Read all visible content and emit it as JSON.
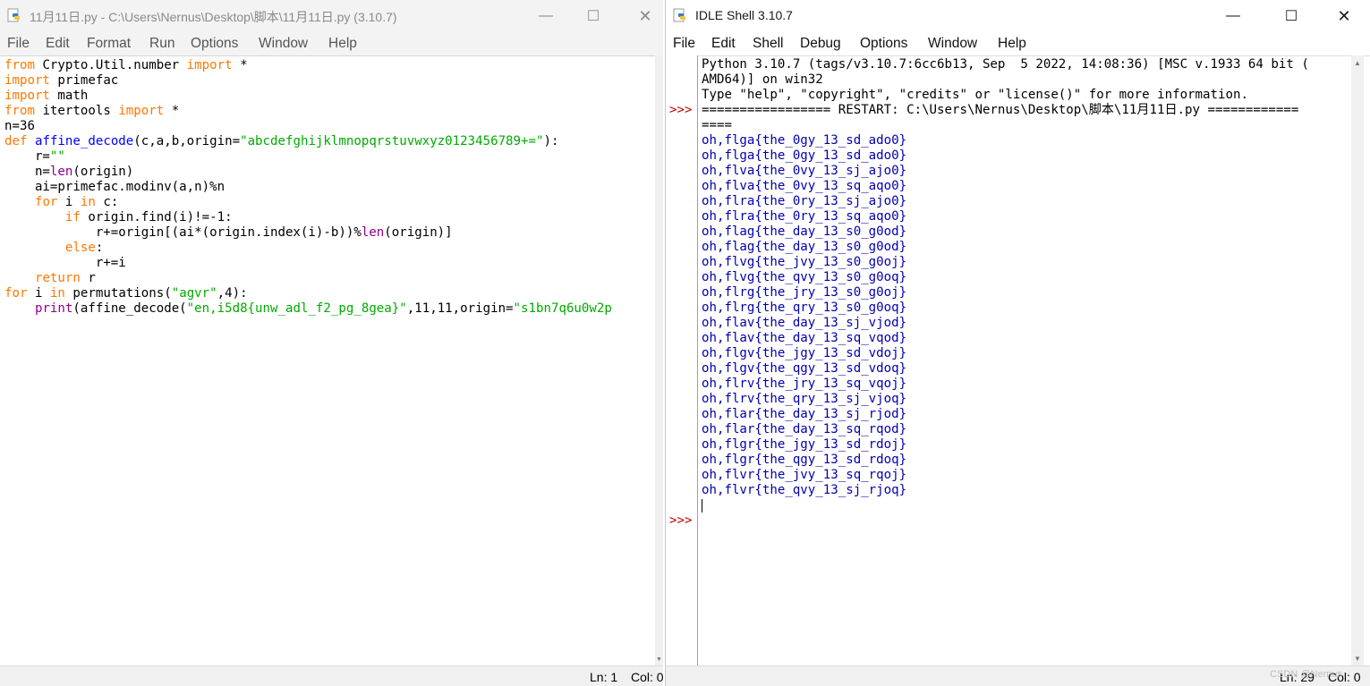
{
  "editor": {
    "title": "11月11日.py - C:\\Users\\Nernus\\Desktop\\脚本\\11月11日.py (3.10.7)",
    "menu": [
      "File",
      "Edit",
      "Format",
      "Run",
      "Options",
      "Window",
      "Help"
    ],
    "code": {
      "l1": {
        "a": "from",
        "b": " Crypto.Util.number ",
        "c": "import",
        "d": " *"
      },
      "l2": {
        "a": "import",
        "b": " primefac"
      },
      "l3": {
        "a": "import",
        "b": " math"
      },
      "l4": {
        "a": "from",
        "b": " itertools ",
        "c": "import",
        "d": " *"
      },
      "l5": {
        "a": "n=36"
      },
      "l6": {
        "a": "def",
        "b": " ",
        "c": "affine_decode",
        "d": "(c,a,b,origin=",
        "e": "\"abcdefghijklmnopqrstuvwxyz0123456789+=\"",
        "f": "):"
      },
      "l7": {
        "a": "    r=",
        "b": "\"\""
      },
      "l8": {
        "a": "    n=",
        "b": "len",
        "c": "(origin)"
      },
      "l9": {
        "a": "    ai=primefac.modinv(a,n)%n"
      },
      "l10": {
        "a": "    ",
        "b": "for",
        "c": " i ",
        "d": "in",
        "e": " c:"
      },
      "l11": {
        "a": "        ",
        "b": "if",
        "c": " origin.find(i)!=-1:"
      },
      "l12": {
        "a": "            r+=origin[(ai*(origin.index(i)-b))%",
        "b": "len",
        "c": "(origin)]"
      },
      "l13": {
        "a": "        ",
        "b": "else",
        "c": ":"
      },
      "l14": {
        "a": "            r+=i"
      },
      "l15": {
        "a": "    ",
        "b": "return",
        "c": " r"
      },
      "l16": {
        "a": "for",
        "b": " i ",
        "c": "in",
        "d": " permutations(",
        "e": "\"agvr\"",
        "f": ",4):"
      },
      "l17": {
        "a": "    ",
        "b": "print",
        "c": "(affine_decode(",
        "d": "\"en,i5d8{unw_adl_f2_pg_8gea}\"",
        "e": ",11,11,origin=",
        "f": "\"s1bn7q6u0w2p"
      }
    },
    "status": {
      "ln": "Ln: 1",
      "col": "Col: 0"
    }
  },
  "shell": {
    "title": "IDLE Shell 3.10.7",
    "menu": [
      "File",
      "Edit",
      "Shell",
      "Debug",
      "Options",
      "Window",
      "Help"
    ],
    "prompt": ">>>",
    "banner": [
      "Python 3.10.7 (tags/v3.10.7:6cc6b13, Sep  5 2022, 14:08:36) [MSC v.1933 64 bit (",
      "AMD64)] on win32",
      "Type \"help\", \"copyright\", \"credits\" or \"license()\" for more information."
    ],
    "restart": [
      "================= RESTART: C:\\Users\\Nernus\\Desktop\\脚本\\11月11日.py ============",
      "===="
    ],
    "output": [
      "oh,flga{the_0gy_13_sd_ado0}",
      "oh,flga{the_0gy_13_sd_ado0}",
      "oh,flva{the_0vy_13_sj_ajo0}",
      "oh,flva{the_0vy_13_sq_aqo0}",
      "oh,flra{the_0ry_13_sj_ajo0}",
      "oh,flra{the_0ry_13_sq_aqo0}",
      "oh,flag{the_day_13_s0_g0od}",
      "oh,flag{the_day_13_s0_g0od}",
      "oh,flvg{the_jvy_13_s0_g0oj}",
      "oh,flvg{the_qvy_13_s0_g0oq}",
      "oh,flrg{the_jry_13_s0_g0oj}",
      "oh,flrg{the_qry_13_s0_g0oq}",
      "oh,flav{the_day_13_sj_vjod}",
      "oh,flav{the_day_13_sq_vqod}",
      "oh,flgv{the_jgy_13_sd_vdoj}",
      "oh,flgv{the_qgy_13_sd_vdoq}",
      "oh,flrv{the_jry_13_sq_vqoj}",
      "oh,flrv{the_qry_13_sj_vjoq}",
      "oh,flar{the_day_13_sj_rjod}",
      "oh,flar{the_day_13_sq_rqod}",
      "oh,flgr{the_jgy_13_sd_rdoj}",
      "oh,flgr{the_qgy_13_sd_rdoq}",
      "oh,flvr{the_jvy_13_sq_rqoj}",
      "oh,flvr{the_qvy_13_sj_rjoq}"
    ],
    "status": {
      "ln": "Ln: 29",
      "col": "Col: 0"
    },
    "watermark": "CSDN @Nernus"
  }
}
